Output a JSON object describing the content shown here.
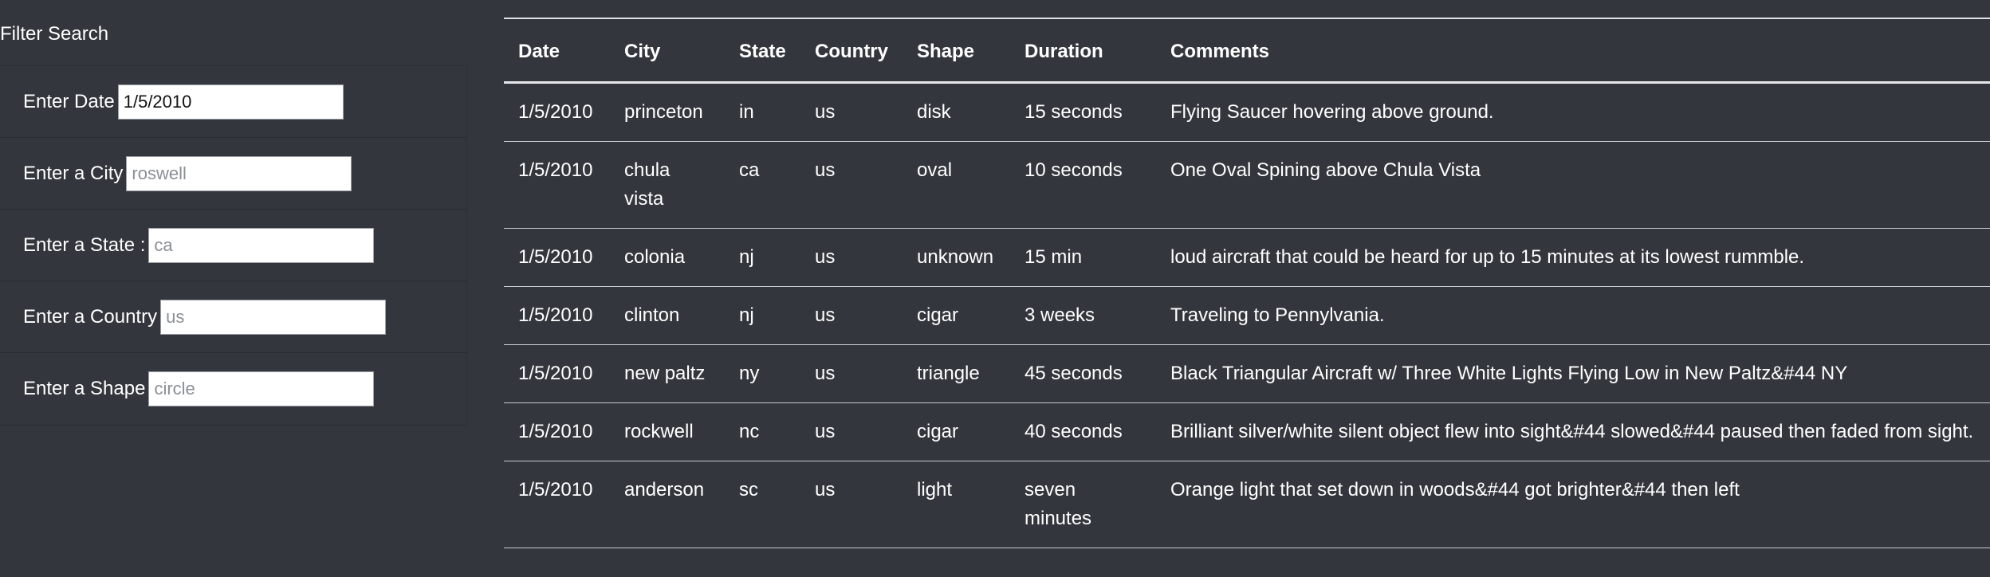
{
  "filter": {
    "title": "Filter Search",
    "fields": [
      {
        "label": "Enter Date",
        "value": "1/5/2010",
        "placeholder": ""
      },
      {
        "label": "Enter a City",
        "value": "",
        "placeholder": "roswell"
      },
      {
        "label": "Enter a State :",
        "value": "",
        "placeholder": "ca"
      },
      {
        "label": "Enter a Country",
        "value": "",
        "placeholder": "us"
      },
      {
        "label": "Enter a Shape",
        "value": "",
        "placeholder": "circle"
      }
    ]
  },
  "table": {
    "headers": [
      "Date",
      "City",
      "State",
      "Country",
      "Shape",
      "Duration",
      "Comments"
    ],
    "rows": [
      [
        "1/5/2010",
        "princeton",
        "in",
        "us",
        "disk",
        "15 seconds",
        "Flying Saucer hovering above ground."
      ],
      [
        "1/5/2010",
        "chula vista",
        "ca",
        "us",
        "oval",
        "10 seconds",
        "One Oval Spining above Chula Vista"
      ],
      [
        "1/5/2010",
        "colonia",
        "nj",
        "us",
        "unknown",
        "15 min",
        "loud aircraft that could be heard for up to 15 minutes at its lowest rummble."
      ],
      [
        "1/5/2010",
        "clinton",
        "nj",
        "us",
        "cigar",
        "3 weeks",
        "Traveling to Pennylvania."
      ],
      [
        "1/5/2010",
        "new paltz",
        "ny",
        "us",
        "triangle",
        "45 seconds",
        "Black Triangular Aircraft w/ Three White Lights Flying Low in New Paltz&#44 NY"
      ],
      [
        "1/5/2010",
        "rockwell",
        "nc",
        "us",
        "cigar",
        "40 seconds",
        "Brilliant silver/white silent object flew into sight&#44 slowed&#44 paused then faded from sight."
      ],
      [
        "1/5/2010",
        "anderson",
        "sc",
        "us",
        "light",
        "seven minutes",
        "Orange light that set down in woods&#44 got brighter&#44 then left"
      ]
    ]
  }
}
